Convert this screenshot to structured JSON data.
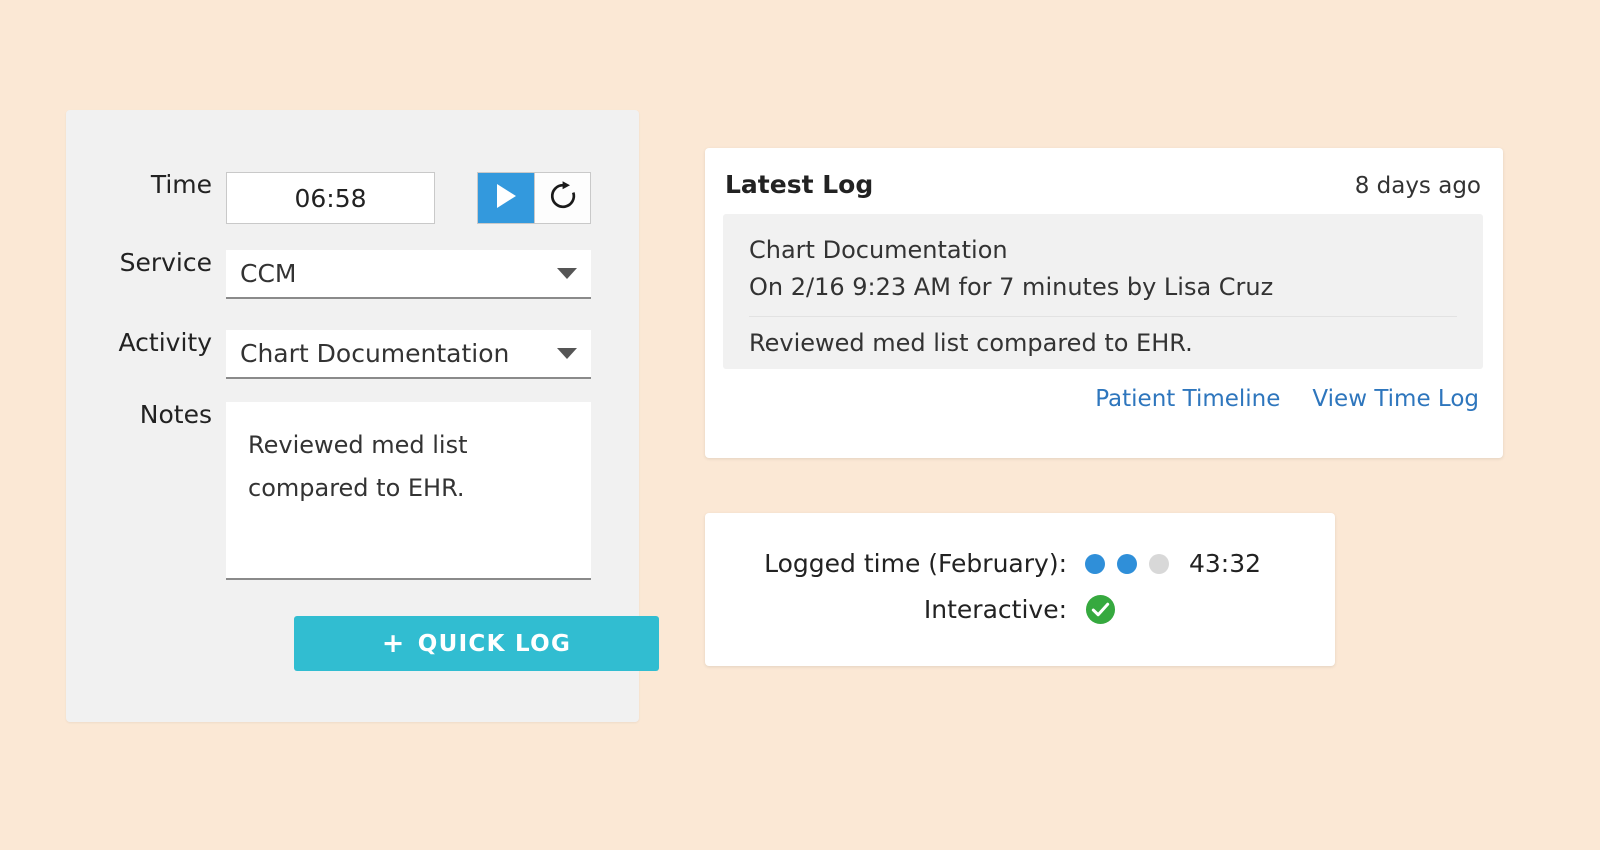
{
  "background_color": "#fbe8d5",
  "time_entry": {
    "panel_background": "#f1f1f1",
    "time": {
      "label": "Time",
      "value": "06:58",
      "play_icon": "play-icon",
      "refresh_icon": "refresh-icon",
      "play_button_color": "#3399dd"
    },
    "service": {
      "label": "Service",
      "value": "CCM",
      "caret_icon": "chevron-down-icon"
    },
    "activity": {
      "label": "Activity",
      "value": "Chart Documentation",
      "caret_icon": "chevron-down-icon"
    },
    "notes": {
      "label": "Notes",
      "value": "Reviewed med list compared to EHR.",
      "placeholder": ""
    },
    "quick_log": {
      "plus": "+",
      "label": "QUICK LOG",
      "color": "#31bdd1"
    }
  },
  "latest_log": {
    "title": "Latest Log",
    "time_ago": "8 days ago",
    "activity": "Chart Documentation",
    "meta": "On 2/16 9:23 AM for 7 minutes by Lisa Cruz",
    "note": "Reviewed med list compared to EHR.",
    "links": [
      {
        "label": "Patient Timeline"
      },
      {
        "label": "View Time Log"
      }
    ],
    "link_color": "#2e76bd"
  },
  "summary": {
    "logged_time": {
      "label": "Logged time (February):",
      "value": "43:32",
      "dots": [
        "on",
        "on",
        "off"
      ],
      "dot_on_color": "#2f8fd9",
      "dot_off_color": "#d8d8d8"
    },
    "interactive": {
      "label": "Interactive:",
      "status_icon": "check-circle-icon",
      "status_color": "#36a93f"
    }
  }
}
